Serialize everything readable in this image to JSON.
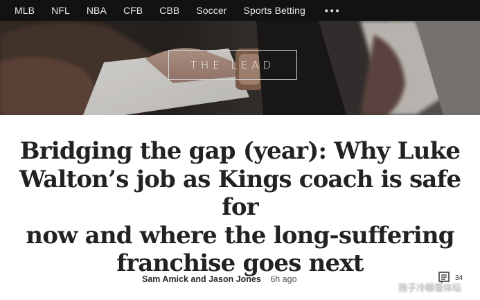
{
  "nav": {
    "items": [
      "MLB",
      "NFL",
      "NBA",
      "CFB",
      "CBB",
      "Soccer",
      "Sports Betting"
    ],
    "more_label": "•••"
  },
  "hero": {
    "label": "THE LEAD"
  },
  "article": {
    "headline_lines": [
      "Bridging the gap (year): Why Luke",
      "Walton’s job as Kings coach is safe for",
      "now and where the long-suffering",
      "franchise goes next"
    ],
    "authors": "Sam Amick and Jason Jones",
    "time": "6h ago",
    "comment_count": "34"
  },
  "watermark": "狍子冷眼看体坛"
}
